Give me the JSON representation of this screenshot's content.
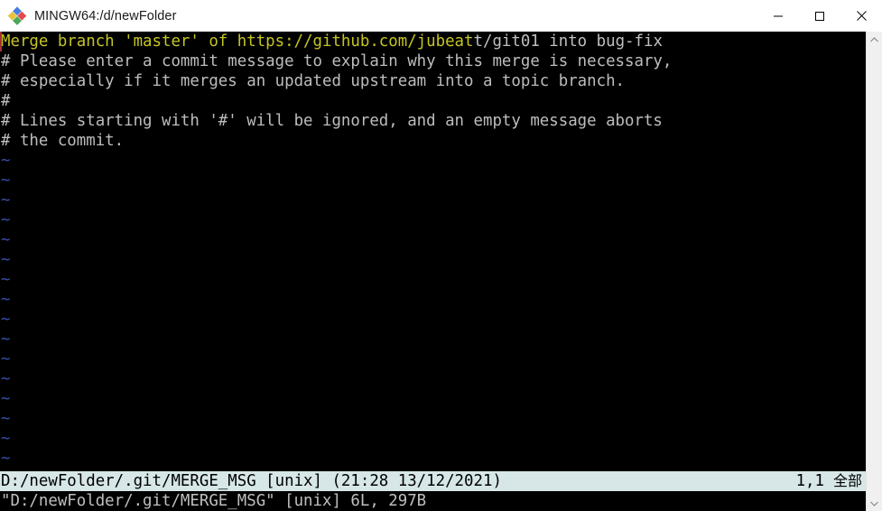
{
  "window": {
    "title": "MINGW64:/d/newFolder",
    "icon": "git-bash-diamond-icon",
    "controls": {
      "minimize_label": "—",
      "maximize_label": "□",
      "close_label": "✕"
    }
  },
  "colors": {
    "terminal_background": "#000000",
    "merge_line": "#c5c523",
    "comment_text": "#bdbdbd",
    "tilde": "#3a4ea8",
    "status_background": "#d7e7e7",
    "status_text": "#000000",
    "cursor": "#a83232",
    "titlebar_background": "#ffffff",
    "titlebar_text": "#1a1a1a"
  },
  "editor": {
    "lines": [
      {
        "kind": "merge",
        "segments": [
          {
            "text": "Merge branch 'master' of https://github.com/jubeat",
            "style": "url"
          },
          {
            "text": "t/git01 into bug-fix",
            "style": "rest"
          }
        ]
      },
      {
        "kind": "comment",
        "text": "# Please enter a commit message to explain why this merge is necessary,"
      },
      {
        "kind": "comment",
        "text": "# especially if it merges an updated upstream into a topic branch."
      },
      {
        "kind": "comment",
        "text": "#"
      },
      {
        "kind": "comment",
        "text": "# Lines starting with '#' will be ignored, and an empty message aborts"
      },
      {
        "kind": "comment",
        "text": "# the commit."
      }
    ],
    "empty_marker": "~",
    "empty_marker_count": 16
  },
  "status": {
    "file": "D:/newFolder/.git/MERGE_MSG [unix] (21:28 13/12/2021)",
    "position": "1,1",
    "scroll": "全部"
  },
  "message": {
    "text": "\"D:/newFolder/.git/MERGE_MSG\" [unix] 6L, 297B"
  },
  "scrollbar": {
    "up_arrow": "▲",
    "down_arrow": "▼"
  }
}
